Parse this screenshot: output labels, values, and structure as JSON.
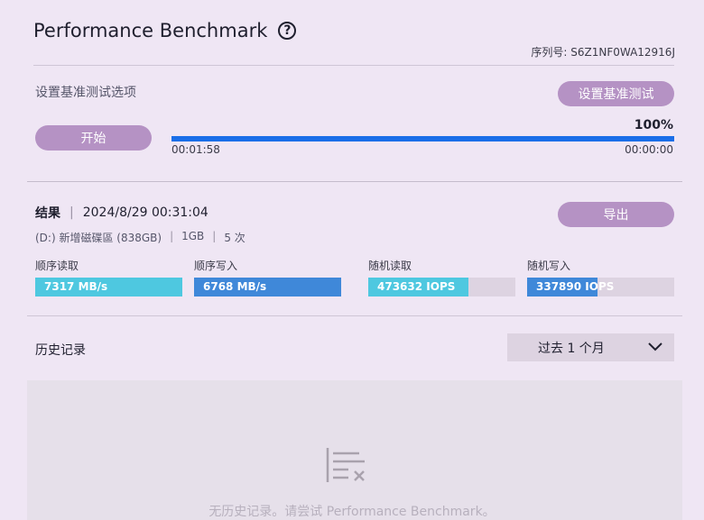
{
  "header": {
    "title": "Performance Benchmark",
    "help_glyph": "?",
    "serial_label": "序列号: S6Z1NF0WA12916J"
  },
  "options": {
    "label": "设置基准测试选项",
    "button": "设置基准测试"
  },
  "run": {
    "start_button": "开始",
    "progress_percent_text": "100%",
    "progress": 1.0,
    "elapsed": "00:01:58",
    "remaining": "00:00:00"
  },
  "results": {
    "label": "结果",
    "timestamp": "2024/8/29 00:31:04",
    "drive": "(D:) 新增磁碟區 (838GB)",
    "size": "1GB",
    "runs": "5 次",
    "export_button": "导出",
    "metrics": [
      {
        "label": "顺序读取",
        "value": "7317 MB/s",
        "fraction": 1.0,
        "color": "#4ec8e0"
      },
      {
        "label": "顺序写入",
        "value": "6768 MB/s",
        "fraction": 1.0,
        "color": "#3f88d9"
      },
      {
        "label": "随机读取",
        "value": "473632 IOPS",
        "fraction": 0.68,
        "color": "#4ec8e0"
      },
      {
        "label": "随机写入",
        "value": "337890 IOPS",
        "fraction": 0.48,
        "color": "#3f88d9"
      }
    ]
  },
  "history": {
    "label": "历史记录",
    "range_selected": "过去 1 个月",
    "empty_message": "无历史记录。请尝试 Performance Benchmark。"
  },
  "icons": [
    "help-icon",
    "chevron-down-icon",
    "empty-list-icon"
  ]
}
